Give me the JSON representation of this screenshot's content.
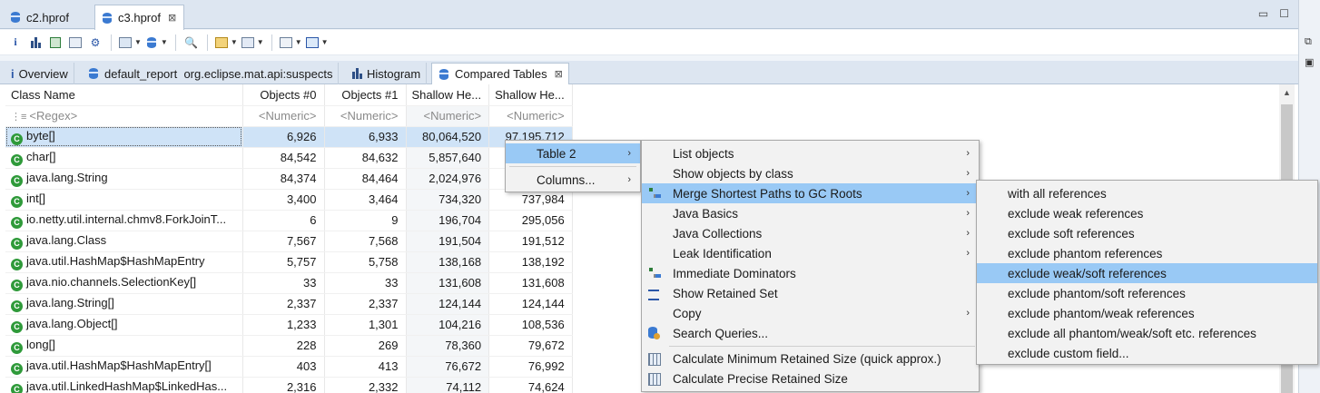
{
  "editor_tabs": [
    {
      "label": "c2.hprof"
    },
    {
      "label": "c3.hprof",
      "close": "⊠"
    }
  ],
  "window_buttons": {
    "minimize": "▭",
    "maximize": "☐"
  },
  "inner_tabs": [
    {
      "glyph": "i",
      "label": "Overview"
    },
    {
      "label": "default_report  org.eclipse.mat.api:suspects"
    },
    {
      "label": "Histogram"
    },
    {
      "label": "Compared Tables",
      "close": "⊠"
    }
  ],
  "table": {
    "headers": [
      "Class Name",
      "Objects #0",
      "Objects #1",
      "Shallow He...",
      "Shallow He..."
    ],
    "filters": [
      "<Regex>",
      "<Numeric>",
      "<Numeric>",
      "<Numeric>",
      "<Numeric>"
    ],
    "rows": [
      {
        "name": "byte[]",
        "c1": "6,926",
        "c2": "6,933",
        "c3": "80,064,520",
        "c4": "97,195,712"
      },
      {
        "name": "char[]",
        "c1": "84,542",
        "c2": "84,632",
        "c3": "5,857,640",
        "c4": ""
      },
      {
        "name": "java.lang.String",
        "c1": "84,374",
        "c2": "84,464",
        "c3": "2,024,976",
        "c4": ""
      },
      {
        "name": "int[]",
        "c1": "3,400",
        "c2": "3,464",
        "c3": "734,320",
        "c4": "737,984"
      },
      {
        "name": "io.netty.util.internal.chmv8.ForkJoinT...",
        "c1": "6",
        "c2": "9",
        "c3": "196,704",
        "c4": "295,056"
      },
      {
        "name": "java.lang.Class",
        "c1": "7,567",
        "c2": "7,568",
        "c3": "191,504",
        "c4": "191,512"
      },
      {
        "name": "java.util.HashMap$HashMapEntry",
        "c1": "5,757",
        "c2": "5,758",
        "c3": "138,168",
        "c4": "138,192"
      },
      {
        "name": "java.nio.channels.SelectionKey[]",
        "c1": "33",
        "c2": "33",
        "c3": "131,608",
        "c4": "131,608"
      },
      {
        "name": "java.lang.String[]",
        "c1": "2,337",
        "c2": "2,337",
        "c3": "124,144",
        "c4": "124,144"
      },
      {
        "name": "java.lang.Object[]",
        "c1": "1,233",
        "c2": "1,301",
        "c3": "104,216",
        "c4": "108,536"
      },
      {
        "name": "long[]",
        "c1": "228",
        "c2": "269",
        "c3": "78,360",
        "c4": "79,672"
      },
      {
        "name": "java.util.HashMap$HashMapEntry[]",
        "c1": "403",
        "c2": "413",
        "c3": "76,672",
        "c4": "76,992"
      },
      {
        "name": "java.util.LinkedHashMap$LinkedHas...",
        "c1": "2,316",
        "c2": "2,332",
        "c3": "74,112",
        "c4": "74,624"
      }
    ]
  },
  "menu1": [
    {
      "label": "Table 2",
      "arrow": "›"
    },
    {
      "label": "Columns...",
      "arrow": "›"
    }
  ],
  "menu2": [
    {
      "label": "List objects",
      "arrow": "›",
      "icon": ""
    },
    {
      "label": "Show objects by class",
      "arrow": "›",
      "icon": ""
    },
    {
      "label": "Merge Shortest Paths to GC Roots",
      "arrow": "›",
      "icon": "tree"
    },
    {
      "label": "Java Basics",
      "arrow": "›",
      "icon": ""
    },
    {
      "label": "Java Collections",
      "arrow": "›",
      "icon": ""
    },
    {
      "label": "Leak Identification",
      "arrow": "›",
      "icon": ""
    },
    {
      "label": "Immediate Dominators",
      "arrow": "",
      "icon": "tree"
    },
    {
      "label": "Show Retained Set",
      "arrow": "",
      "icon": "lines"
    },
    {
      "label": "Copy",
      "arrow": "›",
      "icon": ""
    },
    {
      "label": "Search Queries...",
      "arrow": "",
      "icon": "db"
    },
    {
      "label": "Calculate Minimum Retained Size (quick approx.)",
      "arrow": "",
      "icon": "grid"
    },
    {
      "label": "Calculate Precise Retained Size",
      "arrow": "",
      "icon": "grid"
    }
  ],
  "menu3": [
    {
      "label": "with all references"
    },
    {
      "label": "exclude weak references"
    },
    {
      "label": "exclude soft references"
    },
    {
      "label": "exclude phantom references"
    },
    {
      "label": "exclude weak/soft references"
    },
    {
      "label": "exclude phantom/soft references"
    },
    {
      "label": "exclude phantom/weak references"
    },
    {
      "label": "exclude all phantom/weak/soft etc. references"
    },
    {
      "label": "exclude custom field..."
    }
  ],
  "class_icon_letter": "C",
  "colors": {
    "selection": "#cfe3f7",
    "menu_highlight": "#99c9f5",
    "class_icon": "#2f9a3a"
  }
}
